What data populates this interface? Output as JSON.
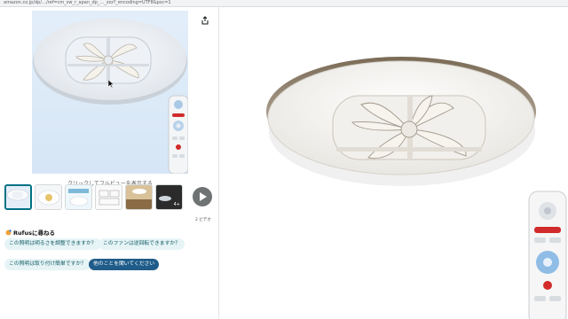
{
  "browser": {
    "url_fragment": "amazon.co.jp/dp/…/ref=cm_sw_r_apan_dp_…_zzz?_encoding=UTF8&psc=1"
  },
  "gallery": {
    "caption": "クリックしてフルビューを表示する",
    "video_label": "2 ビデオ",
    "thumbs_count_badge": "4+"
  },
  "rufus": {
    "title": "Rufusに尋ねる",
    "questions": [
      "この照明は明るさを調整できますか？",
      "このファンは逆回転できますか？",
      "この照明は取り付け簡単ですか？"
    ],
    "ask_more": "他のことを聞いてください"
  },
  "colors": {
    "accent": "#007185",
    "chip_bg": "#e6f4f6",
    "ask_more_bg": "#1f5c8a"
  }
}
